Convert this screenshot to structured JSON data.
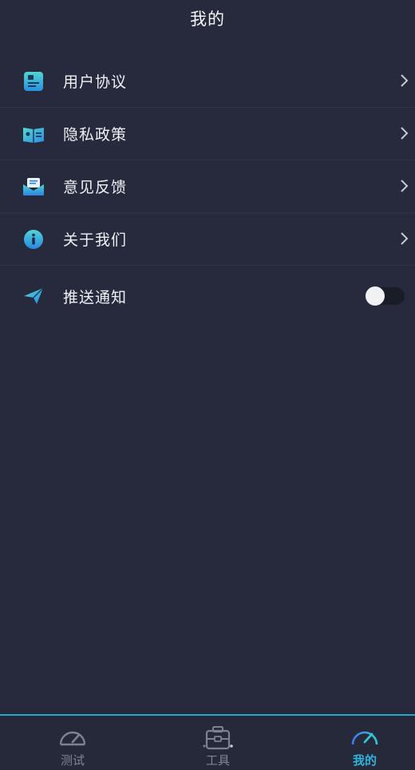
{
  "header": {
    "title": "我的"
  },
  "menu": {
    "items": [
      {
        "label": "用户协议",
        "icon": "user-agreement-icon"
      },
      {
        "label": "隐私政策",
        "icon": "privacy-policy-icon"
      },
      {
        "label": "意见反馈",
        "icon": "feedback-icon"
      },
      {
        "label": "关于我们",
        "icon": "info-icon"
      }
    ],
    "push": {
      "label": "推送通知",
      "icon": "paper-plane-icon",
      "enabled": false
    }
  },
  "tabs": [
    {
      "label": "测试",
      "icon": "speedometer-icon",
      "active": false
    },
    {
      "label": "工具",
      "icon": "toolbox-icon",
      "active": false
    },
    {
      "label": "我的",
      "icon": "speedometer-icon",
      "active": true
    }
  ],
  "colors": {
    "background": "#272a3c",
    "accent": "#31b3dc",
    "tab_inactive": "#808494"
  }
}
